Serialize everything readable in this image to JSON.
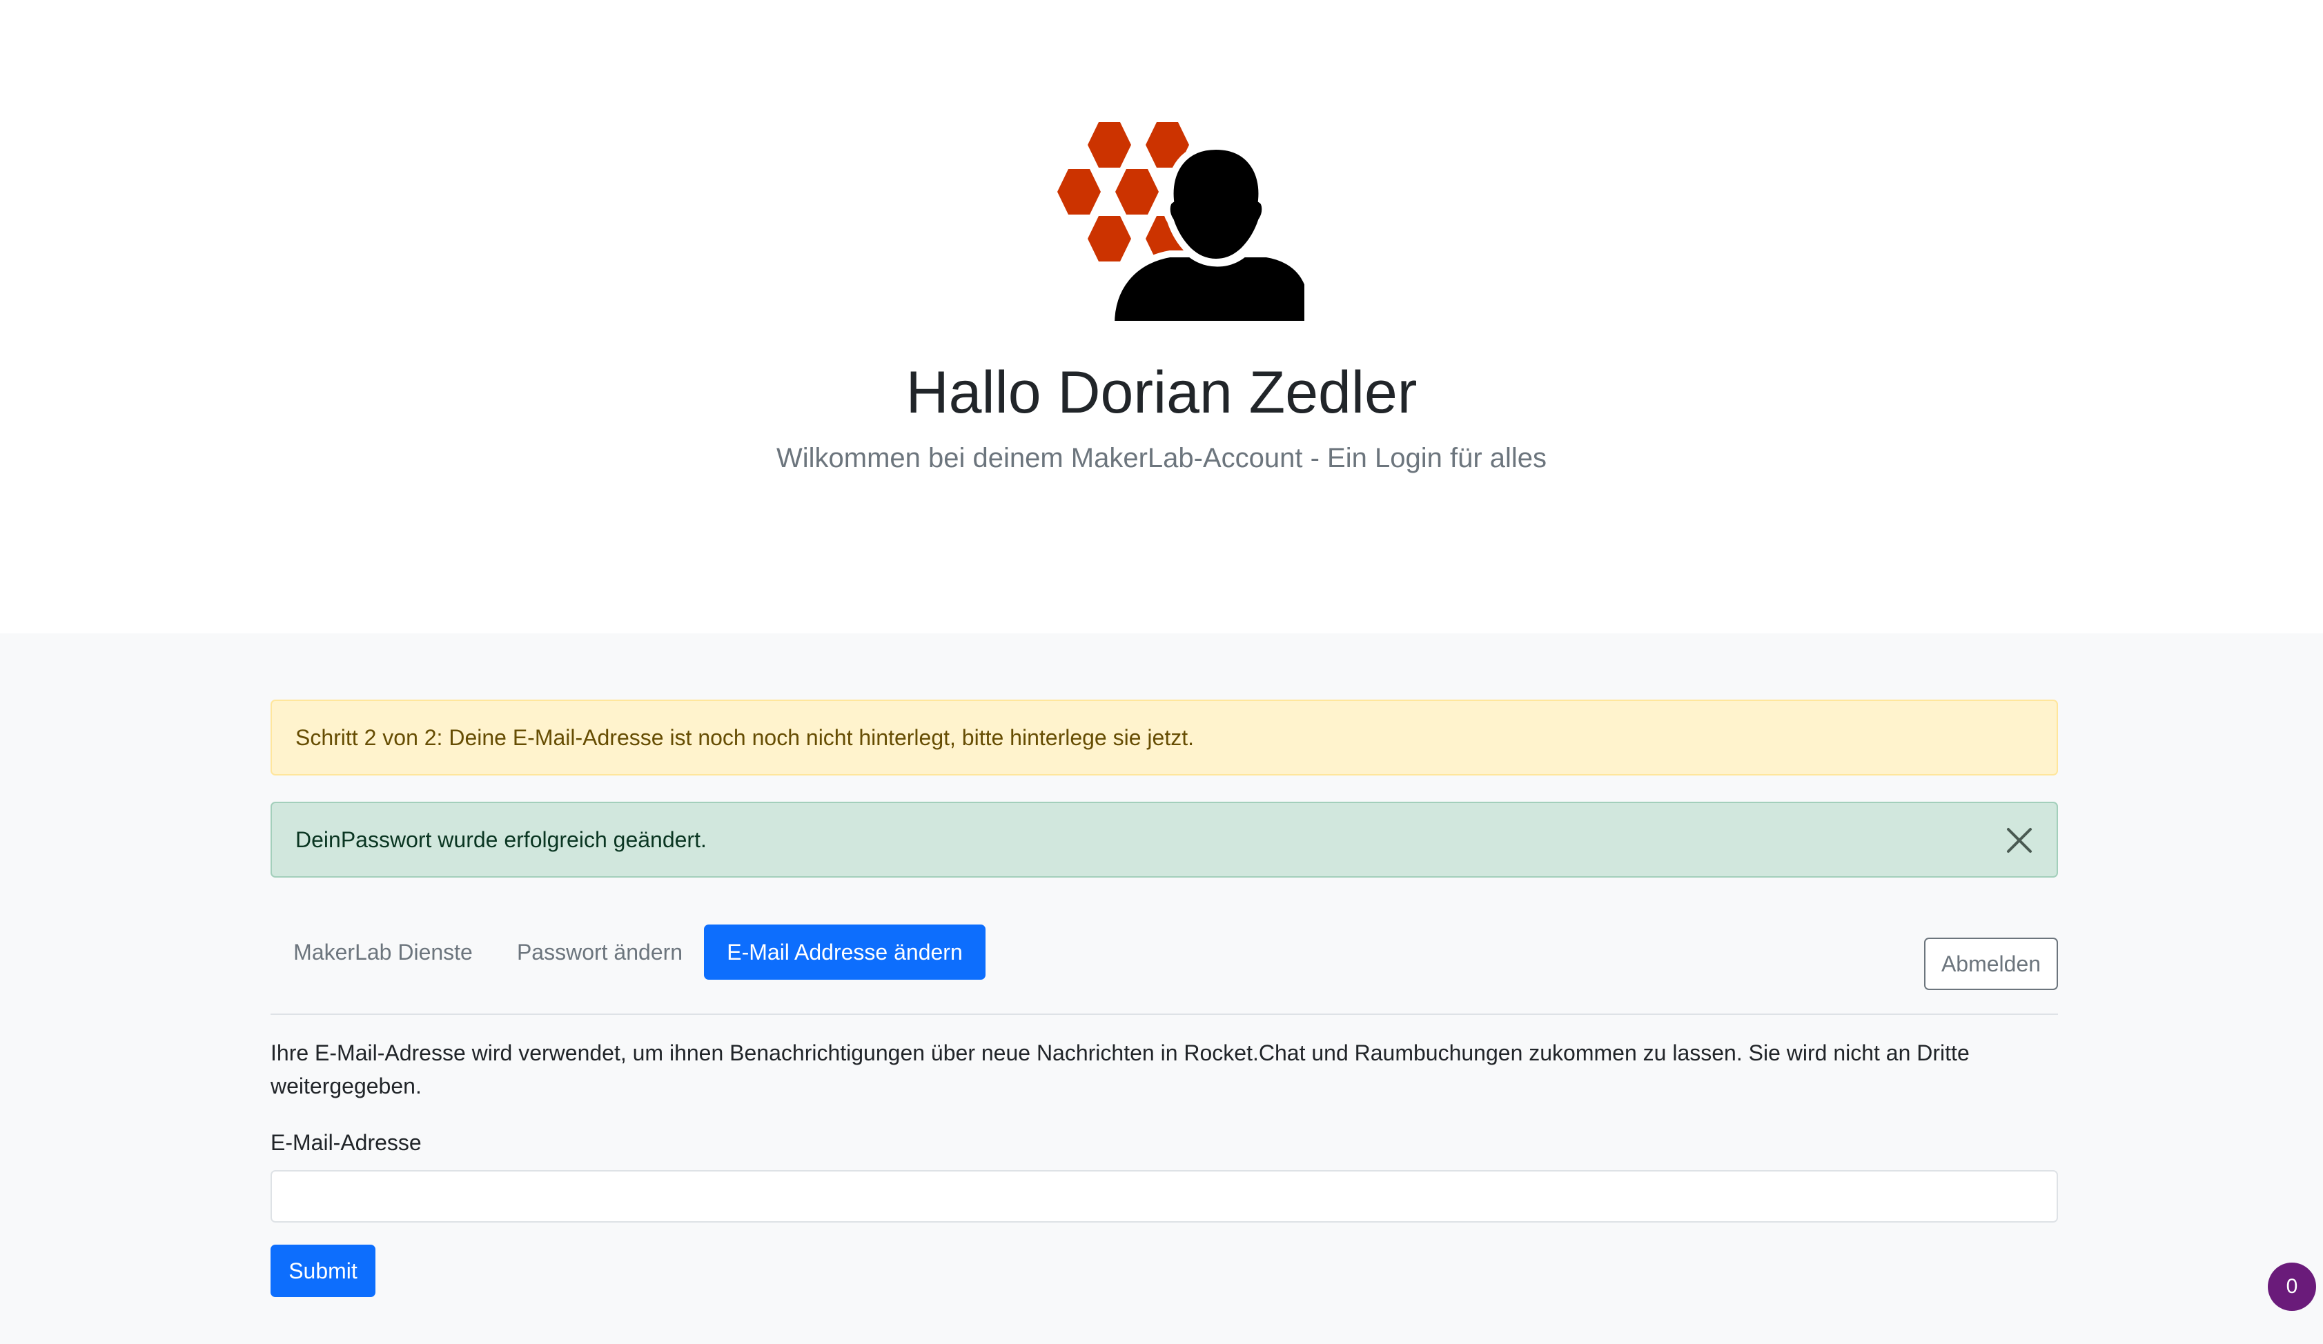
{
  "header": {
    "greeting": "Hallo Dorian Zedler",
    "welcome": "Wilkommen bei deinem MakerLab-Account - Ein Login für alles",
    "logo_icon": "makerlab-user-hexagon-logo"
  },
  "alerts": {
    "warning": "Schritt 2 von 2: Deine E-Mail-Adresse ist noch noch nicht hinterlegt, bitte hinterlege sie jetzt.",
    "success": "DeinPasswort wurde erfolgreich geändert.",
    "close_icon": "close-icon"
  },
  "tabs": [
    {
      "label": "MakerLab Dienste",
      "active": false
    },
    {
      "label": "Passwort ändern",
      "active": false
    },
    {
      "label": "E-Mail Addresse ändern",
      "active": true
    }
  ],
  "logout_label": "Abmelden",
  "email_form": {
    "description": "Ihre E-Mail-Adresse wird verwendet, um ihnen Benachrichtigungen über neue Nachrichten in Rocket.Chat und Raumbuchungen zukommen zu lassen. Sie wird nicht an Dritte weitergegeben.",
    "label": "E-Mail-Adresse",
    "value": "",
    "placeholder": "",
    "submit_label": "Submit"
  },
  "notification_badge": {
    "count": "0"
  },
  "colors": {
    "primary": "#0d6efd",
    "logo_hex": "#cc3300",
    "warning_bg": "#fff3cd",
    "success_bg": "#d1e7dd",
    "badge_bg": "#6a1b7a"
  }
}
